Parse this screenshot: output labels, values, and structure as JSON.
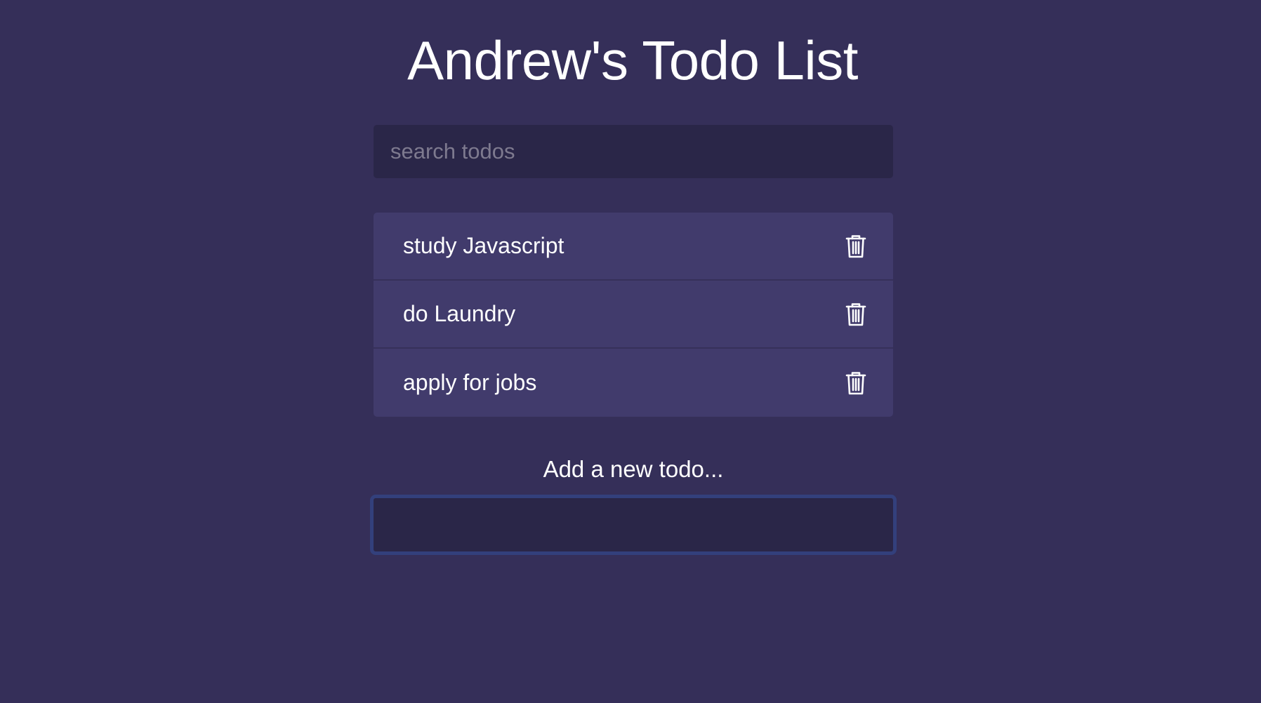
{
  "app": {
    "title": "Andrew's Todo List"
  },
  "search": {
    "placeholder": "search todos",
    "value": ""
  },
  "todos": [
    {
      "label": "study Javascript",
      "icon": "trash-icon"
    },
    {
      "label": "do Laundry",
      "icon": "trash-icon"
    },
    {
      "label": "apply for jobs",
      "icon": "trash-icon"
    }
  ],
  "add": {
    "label": "Add a new todo...",
    "value": ""
  },
  "colors": {
    "background": "#352f59",
    "list_bg": "#413b6c",
    "input_bg": "#2a2648",
    "focus_border": "#33407c"
  }
}
